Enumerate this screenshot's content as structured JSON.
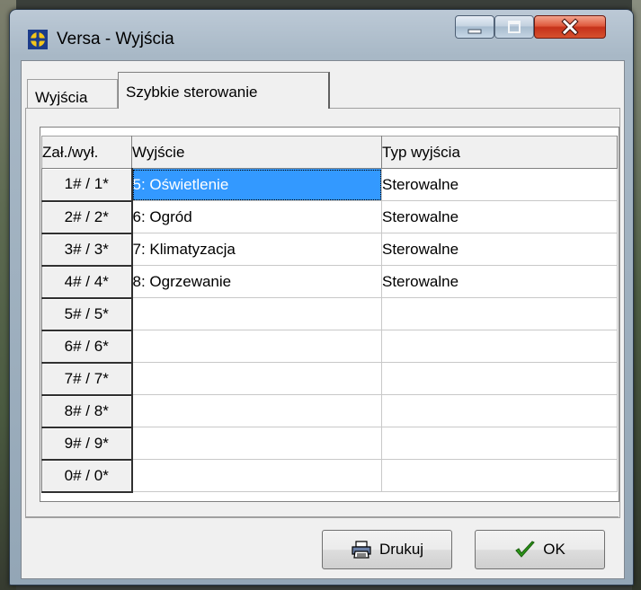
{
  "window": {
    "title": "Versa - Wyjścia",
    "controls": [
      "minimize-icon",
      "maximize-icon",
      "close-icon"
    ]
  },
  "tabs": [
    {
      "label": "Wyjścia",
      "active": false
    },
    {
      "label": "Szybkie sterowanie",
      "active": true
    }
  ],
  "grid": {
    "columns": [
      "Zał./wył.",
      "Wyjście",
      "Typ wyjścia"
    ],
    "rows": [
      {
        "key": "1# / 1*",
        "output": "5: Oświetlenie",
        "type": "Sterowalne",
        "selected": true
      },
      {
        "key": "2# / 2*",
        "output": "6: Ogród",
        "type": "Sterowalne"
      },
      {
        "key": "3# / 3*",
        "output": "7: Klimatyzacja",
        "type": "Sterowalne"
      },
      {
        "key": "4# / 4*",
        "output": "8: Ogrzewanie",
        "type": "Sterowalne"
      },
      {
        "key": "5# / 5*",
        "output": "",
        "type": ""
      },
      {
        "key": "6# / 6*",
        "output": "",
        "type": ""
      },
      {
        "key": "7# / 7*",
        "output": "",
        "type": ""
      },
      {
        "key": "8# / 8*",
        "output": "",
        "type": ""
      },
      {
        "key": "9# / 9*",
        "output": "",
        "type": ""
      },
      {
        "key": "0# / 0*",
        "output": "",
        "type": ""
      }
    ]
  },
  "buttons": {
    "print": {
      "label": "Drukuj",
      "icon": "printer-icon"
    },
    "ok": {
      "label": "OK",
      "icon": "checkmark-icon"
    }
  },
  "colors": {
    "selection": "#3399ff",
    "close_button": "#c5311a",
    "ok_check": "#2c9a18"
  }
}
